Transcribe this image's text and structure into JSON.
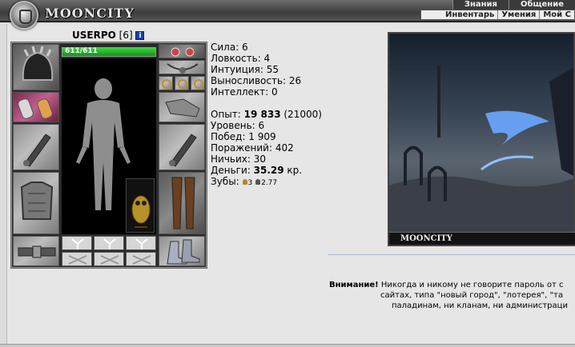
{
  "header": {
    "logo_text": "MOONCITY",
    "menu_top": [
      "Знания",
      "Общение"
    ],
    "menu_bottom": [
      "Инвентарь",
      "Умения",
      "Мой С"
    ]
  },
  "character": {
    "name": "USERPO",
    "level": "[6]",
    "info_icon": "i",
    "hp_text": "611/611",
    "hp_fraction": 1.0
  },
  "stats": {
    "strength": "Сила: 6",
    "agility": "Ловкость: 4",
    "intuition": "Интуиция: 55",
    "endurance": "Выносливость: 26",
    "intellect": "Интеллект: 0",
    "exp_label": "Опыт: ",
    "exp_value": "19 833",
    "exp_next": " (21000)",
    "level": "Уровень: 6",
    "wins": "Побед: 1 909",
    "losses": "Поражений: 402",
    "draws": "Ничьих: 30",
    "money_label": "Деньги: ",
    "money_value": "35.29",
    "money_unit": " кр.",
    "teeth_label": "Зубы: ",
    "teeth_a": "3",
    "teeth_b": "2.77"
  },
  "scene": {
    "label": "MOONCITY"
  },
  "warning": {
    "bold": "Внимание!",
    "line1": " Никогда и никому не говорите пароль от с",
    "line2": "сайтах, типа \"новый город\", \"лотерея\", \"та",
    "line3": "паладинам, ни кланам, ни администраци"
  }
}
